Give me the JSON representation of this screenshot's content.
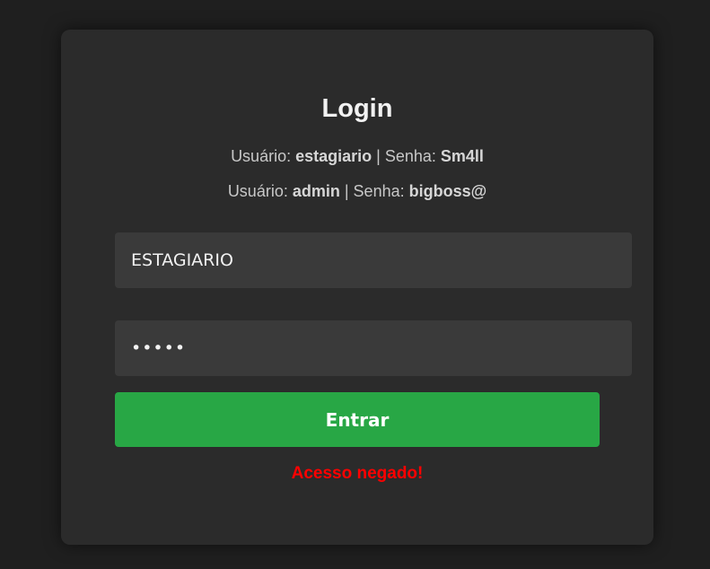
{
  "login": {
    "title": "Login",
    "credentials": [
      {
        "user_label": "Usuário: ",
        "user": "estagiario",
        "sep": " | ",
        "pass_label": "Senha: ",
        "pass": "Sm4ll"
      },
      {
        "user_label": "Usuário: ",
        "user": "admin",
        "sep": " | ",
        "pass_label": "Senha: ",
        "pass": "bigboss@"
      }
    ],
    "username_value": "ESTAGIARIO",
    "password_value": "•••••",
    "submit_label": "Entrar",
    "error_message": "Acesso negado!"
  },
  "colors": {
    "page_background": "#1f1f1f",
    "card_background": "#2b2b2b",
    "input_background": "#3a3a3a",
    "button": "#28a745",
    "error": "#ff0000"
  }
}
